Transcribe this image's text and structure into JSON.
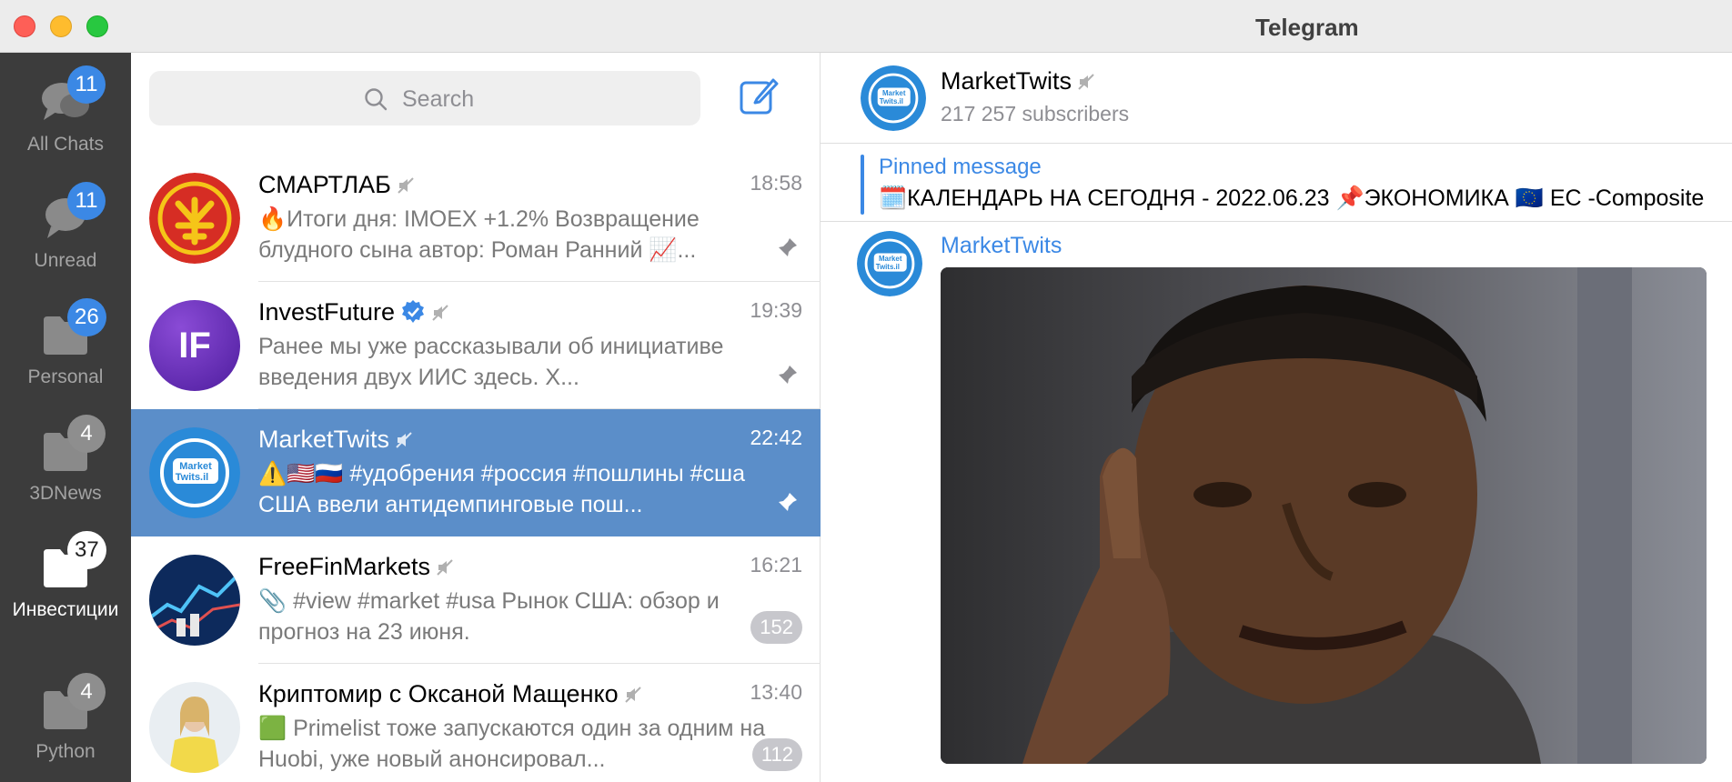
{
  "window": {
    "title": "Telegram"
  },
  "folders": [
    {
      "label": "All Chats",
      "badge": "11"
    },
    {
      "label": "Unread",
      "badge": "11"
    },
    {
      "label": "Personal",
      "badge": "26"
    },
    {
      "label": "3DNews",
      "badge": "4"
    },
    {
      "label": "Инвестиции",
      "badge": "37"
    },
    {
      "label": "Python",
      "badge": "4"
    }
  ],
  "search": {
    "placeholder": "Search"
  },
  "chats": [
    {
      "name": "СМАРТЛАБ",
      "time": "18:58",
      "preview": "🔥Итоги дня: IMOEX +1.2% Возвращение блудного сына автор: Роман Ранний   📈...",
      "pinned": true
    },
    {
      "name": "InvestFuture",
      "time": "19:39",
      "preview": "Ранее мы уже рассказывали об инициативе введения двух ИИС здесь. Х...",
      "pinned": true,
      "avatar_text": "IF"
    },
    {
      "name": "MarketTwits",
      "time": "22:42",
      "preview": "⚠️🇺🇸🇷🇺 #удобрения #россия #пошлины #сша  США ввели антидемпинговые пош...",
      "pinned": true
    },
    {
      "name": "FreeFinMarkets",
      "time": "16:21",
      "preview": "📎 #view #market #usa Рынок США: обзор и прогноз на 23 июня.",
      "unread": "152"
    },
    {
      "name": "Криптомир с Оксаной Мащенко",
      "time": "13:40",
      "preview": "🟩 Primelist тоже запускаются один за одним на Huobi, уже новый анонсировал...",
      "unread": "112"
    }
  ],
  "chat": {
    "name": "MarketTwits",
    "subscribers": "217 257 subscribers",
    "pinned_title": "Pinned message",
    "pinned_text": "🗓️КАЛЕНДАРЬ НА СЕГОДНЯ - 2022.06.23  📌ЭКОНОМИКА 🇪🇺 ЕС -Composite",
    "message_author": "MarketTwits"
  },
  "colors": {
    "accent": "#3b88e5",
    "selected_row": "#5b8ec9",
    "sidebar": "#3c3c3c"
  }
}
